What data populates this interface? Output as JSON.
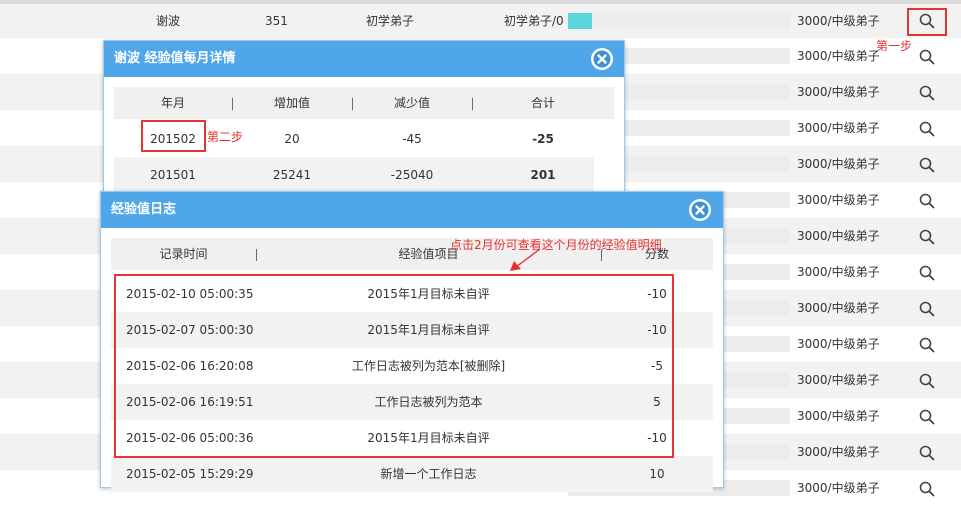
{
  "list": {
    "first_row": {
      "name": "谢波",
      "count": "351",
      "rank": "初学弟子",
      "progress_text": "初学弟子/0",
      "progress_fraction": 0.11,
      "max_text": "3000/中级弟子"
    },
    "repeat_max_text": "3000/中级弟子"
  },
  "annotations": {
    "step1": "第一步",
    "step2": "第二步",
    "hint": "点击2月份可查看这个月份的经验值明细"
  },
  "monthly_dialog": {
    "title": "谢波 经验值每月详情",
    "columns": [
      "年月",
      "增加值",
      "减少值",
      "合计"
    ],
    "rows": [
      {
        "month": "201502",
        "add": "20",
        "sub": "-45",
        "total": "-25"
      },
      {
        "month": "201501",
        "add": "25241",
        "sub": "-25040",
        "total": "201"
      }
    ]
  },
  "log_dialog": {
    "title": "经验值日志",
    "columns": [
      "记录时间",
      "经验值项目",
      "分数"
    ],
    "rows": [
      {
        "time": "2015-02-10 05:00:35",
        "item": "2015年1月目标未自评",
        "score": "-10"
      },
      {
        "time": "2015-02-07 05:00:30",
        "item": "2015年1月目标未自评",
        "score": "-10"
      },
      {
        "time": "2015-02-06 16:20:08",
        "item": "工作日志被列为范本[被删除]",
        "score": "-5"
      },
      {
        "time": "2015-02-06 16:19:51",
        "item": "工作日志被列为范本",
        "score": "5"
      },
      {
        "time": "2015-02-06 05:00:36",
        "item": "2015年1月目标未自评",
        "score": "-10"
      },
      {
        "time": "2015-02-05 15:29:29",
        "item": "新增一个工作日志",
        "score": "10"
      }
    ]
  },
  "colors": {
    "accent": "#4fa7e9",
    "annotation": "#e53333",
    "progress": "#5bd6dc"
  },
  "icons": [
    "search-icon",
    "close-icon"
  ]
}
